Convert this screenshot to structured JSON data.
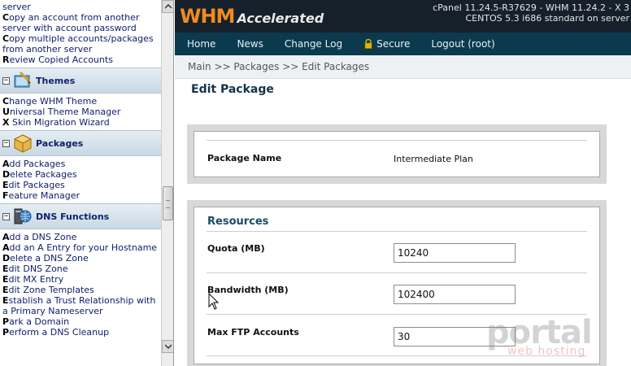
{
  "sidebar": {
    "top_links": [
      {
        "first": "",
        "rest": "server"
      },
      {
        "first": "C",
        "rest": "opy an account from another server with account password"
      },
      {
        "first": "C",
        "rest": "opy multiple accounts/packages from another server"
      },
      {
        "first": "R",
        "rest": "eview Copied Accounts"
      }
    ],
    "sections": [
      {
        "title": "Themes",
        "icon": "themes-icon",
        "links": [
          {
            "first": "C",
            "rest": "hange WHM Theme"
          },
          {
            "first": "U",
            "rest": "niversal Theme Manager"
          },
          {
            "first": "X",
            "rest": " Skin Migration Wizard"
          }
        ]
      },
      {
        "title": "Packages",
        "icon": "packages-icon",
        "links": [
          {
            "first": "A",
            "rest": "dd Packages"
          },
          {
            "first": "D",
            "rest": "elete Packages"
          },
          {
            "first": "E",
            "rest": "dit Packages"
          },
          {
            "first": "F",
            "rest": "eature Manager"
          }
        ]
      },
      {
        "title": "DNS Functions",
        "icon": "dns-icon",
        "links": [
          {
            "first": "A",
            "rest": "dd a DNS Zone"
          },
          {
            "first": "A",
            "rest": "dd an A Entry for your Hostname"
          },
          {
            "first": "D",
            "rest": "elete a DNS Zone"
          },
          {
            "first": "E",
            "rest": "dit DNS Zone"
          },
          {
            "first": "E",
            "rest": "dit MX Entry"
          },
          {
            "first": "E",
            "rest": "dit Zone Templates"
          },
          {
            "first": "E",
            "rest": "stablish a Trust Relationship with a Primary Nameserver"
          },
          {
            "first": "P",
            "rest": "ark a Domain"
          },
          {
            "first": "P",
            "rest": "erform a DNS Cleanup"
          }
        ]
      }
    ]
  },
  "header": {
    "logo_main": "WHM",
    "logo_sub": "Accelerated",
    "version_line1": "cPanel 11.24.5-R37629 - WHM 11.24.2 - X 3",
    "version_line2": "CENTOS 5.3 i686 standard on server"
  },
  "nav": {
    "home": "Home",
    "news": "News",
    "changelog": "Change Log",
    "secure": "Secure",
    "logout": "Logout (root)"
  },
  "breadcrumb": "Main >> Packages >> Edit Packages",
  "page_title": "Edit Package",
  "package": {
    "name_label": "Package Name",
    "name_value": "Intermediate Plan"
  },
  "resources": {
    "title": "Resources",
    "quota_label": "Quota (MB)",
    "quota_value": "10240",
    "bandwidth_label": "Bandwidth (MB)",
    "bandwidth_value": "102400",
    "ftp_label": "Max FTP Accounts",
    "ftp_value": "30"
  },
  "watermark": {
    "main": "portal",
    "sub": "web hosting"
  },
  "colors": {
    "accent_orange": "#f08a1e",
    "nav_bg": "#0b3a4e",
    "header_bg": "#15202a",
    "link_blue": "#10216b"
  }
}
